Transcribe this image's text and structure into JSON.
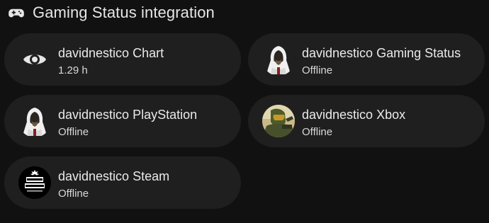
{
  "header": {
    "title": "Gaming Status integration",
    "icon": "gamepad-icon"
  },
  "cards": [
    {
      "name": "davidnestico Chart",
      "state": "1.29 h",
      "icon": "eye-icon"
    },
    {
      "name": "davidnestico Gaming Status",
      "state": "Offline",
      "icon": "hooded-avatar-icon"
    },
    {
      "name": "davidnestico PlayStation",
      "state": "Offline",
      "icon": "hooded-avatar-icon"
    },
    {
      "name": "davidnestico Xbox",
      "state": "Offline",
      "icon": "soldier-avatar-icon"
    },
    {
      "name": "davidnestico Steam",
      "state": "Offline",
      "icon": "david-nestico-logo-avatar"
    }
  ],
  "colors": {
    "background": "#111111",
    "card": "#1f1f1f",
    "text": "#eaeaea"
  }
}
